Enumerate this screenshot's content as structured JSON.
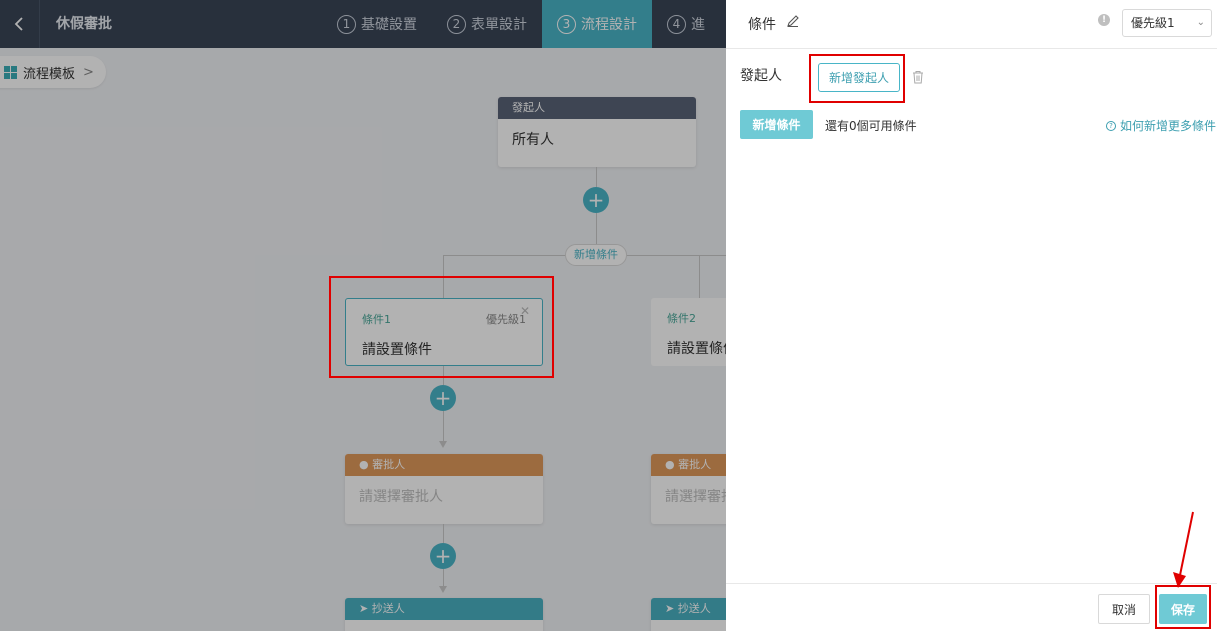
{
  "topbar": {
    "title": "休假審批",
    "steps": [
      {
        "num": "1",
        "label": "基礎設置"
      },
      {
        "num": "2",
        "label": "表單設計"
      },
      {
        "num": "3",
        "label": "流程設計"
      },
      {
        "num": "4",
        "label": "進"
      }
    ]
  },
  "canvas": {
    "template_label": "流程模板",
    "initiator_node": {
      "header": "發起人",
      "body": "所有人"
    },
    "add_condition_label": "新增條件",
    "conditions": [
      {
        "name": "條件1",
        "priority": "優先級1",
        "body": "請設置條件"
      },
      {
        "name": "條件2",
        "body": "請設置條件"
      }
    ],
    "approver_node": {
      "header": "審批人",
      "body": "請選擇審批人"
    },
    "cc_node": {
      "header": "抄送人"
    }
  },
  "panel": {
    "title": "條件",
    "priority_selected": "優先級1",
    "initiator_label": "發起人",
    "add_initiator_button": "新增發起人",
    "add_condition_button": "新增條件",
    "remaining_text": "還有0個可用條件",
    "help_link": "如何新增更多條件",
    "cancel_button": "取消",
    "save_button": "保存"
  },
  "colors": {
    "accent": "#49b5c7",
    "topbar": "#3a4557",
    "approver": "#e09a5b",
    "annotation": "#e00000"
  }
}
